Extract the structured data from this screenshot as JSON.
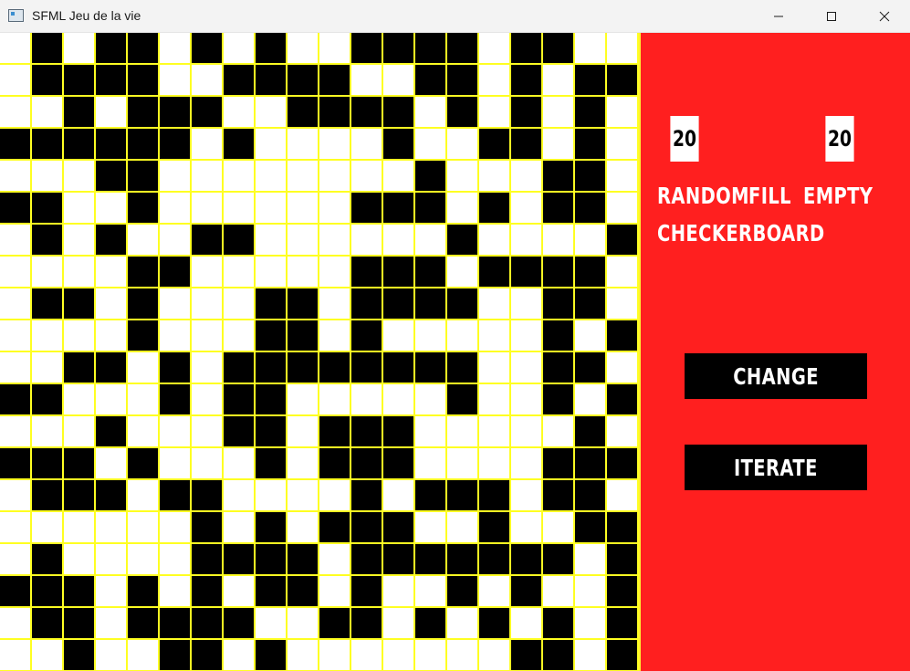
{
  "window": {
    "title": "SFML Jeu de la vie",
    "icon": "app-window-icon",
    "controls": [
      "minimize-icon",
      "maximize-icon",
      "close-icon"
    ]
  },
  "grid": {
    "rows": 20,
    "cols": 20,
    "alive_color": "#000000",
    "dead_color": "#ffffff",
    "line_color": "#ffff22",
    "cells": [
      "01011010100111101100",
      "01111001111001101011",
      "00101110011110101010",
      "11111101000010011010",
      "00011000000001000110",
      "11001000000111010110",
      "01010011000000100001",
      "00001100000111011110",
      "01101000110111100110",
      "00001000110100000101",
      "00110101111111100110",
      "11000101100000100101",
      "00010001101110000010",
      "11101000101110000111",
      "01110110000101110110",
      "00000010101110010011",
      "01000011110111111101",
      "11101010110100101001",
      "01101111001101010101",
      "00100110100000001101"
    ]
  },
  "panel": {
    "background": "#ff1f1f",
    "size_a": "20",
    "size_b": "20",
    "options": {
      "random": "RANDOM",
      "fill": "FILL",
      "empty": "EMPTY",
      "checkerboard": "CHECKERBOARD"
    },
    "buttons": {
      "change": "CHANGE",
      "iterate": "ITERATE"
    }
  }
}
